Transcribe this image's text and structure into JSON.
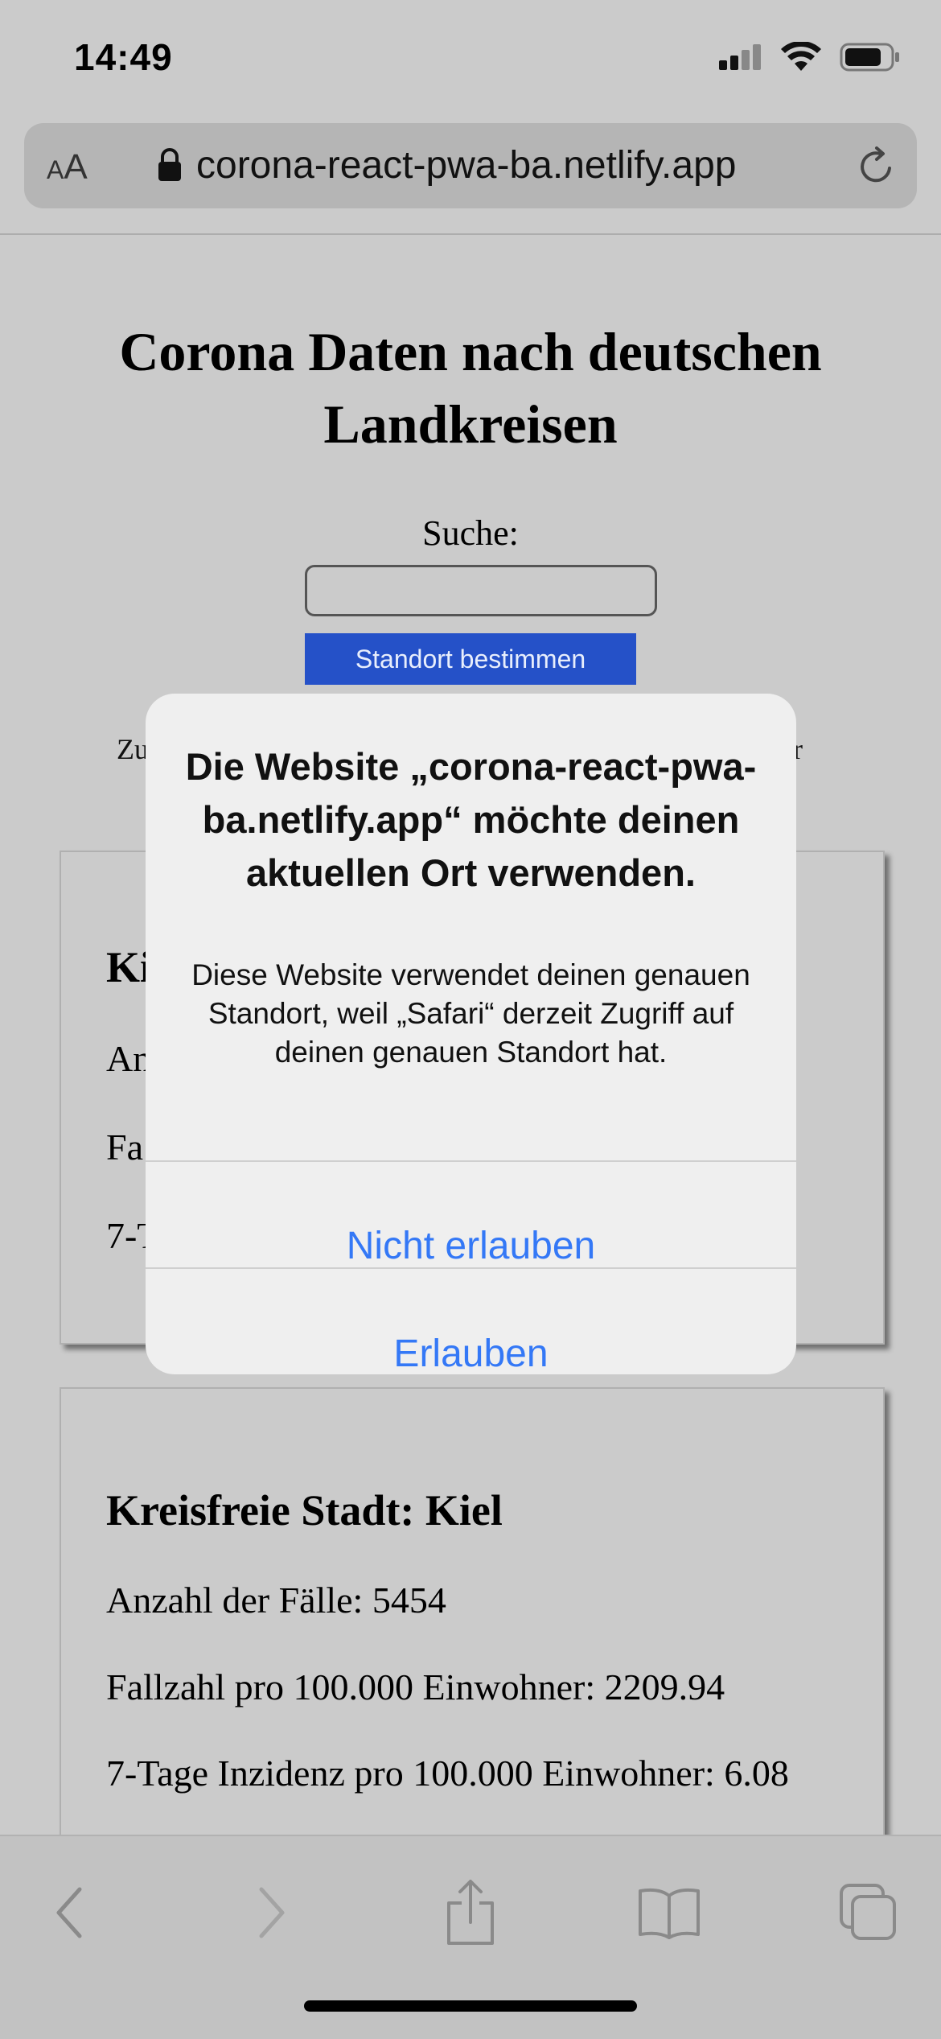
{
  "status_bar": {
    "time": "14:49"
  },
  "browser": {
    "text_size_label_small": "A",
    "text_size_label_large": "A",
    "url": "corona-react-pwa-ba.netlify.app"
  },
  "page": {
    "title": "Corona Daten nach deutschen Landkreisen",
    "search_label": "Suche:",
    "search_value": "",
    "locate_button": "Standort bestimmen",
    "partial_text_left": "Zu",
    "partial_text_right": "hr",
    "cards": [
      {
        "title_visible": "Ki",
        "line1_visible": "An",
        "line2_visible": "Fa",
        "line3_visible": "7-T"
      },
      {
        "title": "Kreisfreie Stadt: Kiel",
        "cases": "Anzahl der Fälle: 5454",
        "cases_per_100k": "Fallzahl pro 100.000 Einwohner: 2209.94",
        "incidence_7day": "7-Tage Inzidenz pro 100.000 Einwohner: 6.08"
      }
    ]
  },
  "alert": {
    "title": "Die Website „corona-react-pwa-ba.netlify.app“ möchte deinen aktuellen Ort verwenden.",
    "message": "Diese Website verwendet deinen genauen Standort, weil „Safari“ derzeit Zugriff auf deinen genauen Standort hat.",
    "deny_button": "Nicht erlauben",
    "allow_button": "Erlauben"
  },
  "toolbar": {
    "icons": [
      "back-icon",
      "forward-icon",
      "share-icon",
      "bookmarks-icon",
      "tabs-icon"
    ]
  },
  "colors": {
    "dimmed_background": "#cbcbcb",
    "button_blue": "#2551c8",
    "alert_link_blue": "#3478f6"
  }
}
